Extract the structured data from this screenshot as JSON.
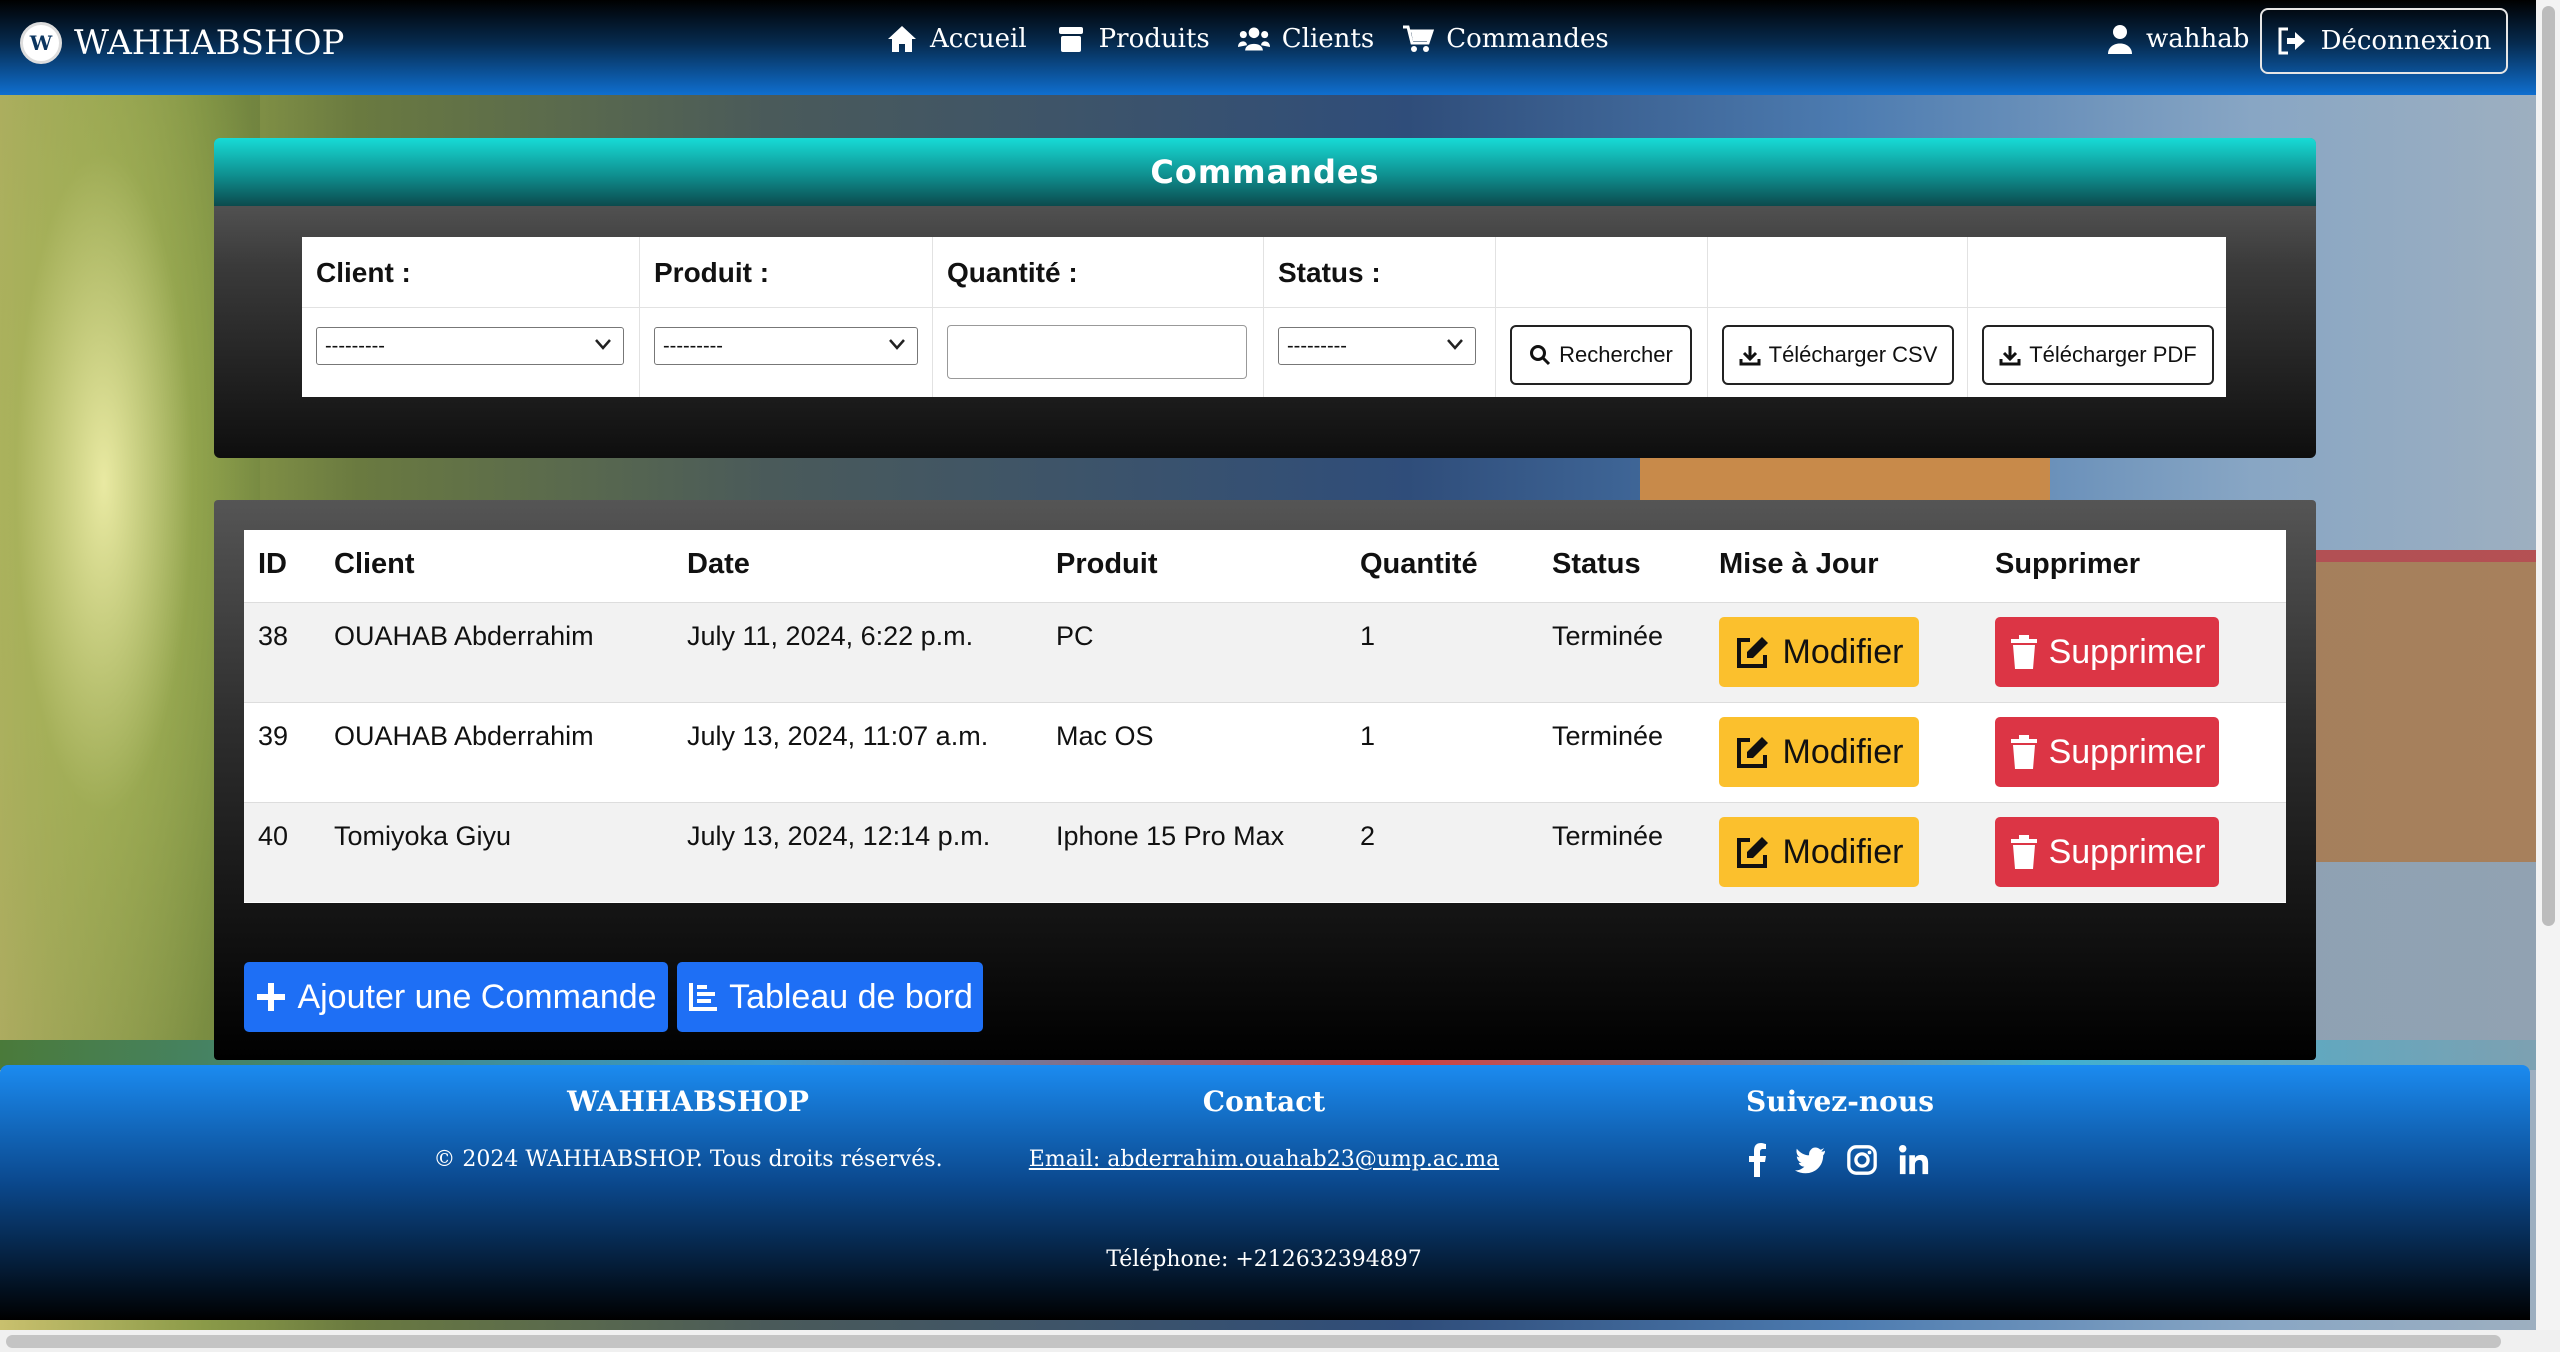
{
  "navbar": {
    "brand": "WAHHABSHOP",
    "links": [
      "Accueil",
      "Produits",
      "Clients",
      "Commandes"
    ],
    "user": "wahhab",
    "logout": "Déconnexion"
  },
  "filter": {
    "title": "Commandes",
    "labels": {
      "client": "Client :",
      "produit": "Produit :",
      "quantite": "Quantité :",
      "status": "Status :"
    },
    "client_selected": "---------",
    "produit_selected": "---------",
    "status_selected": "---------",
    "quantite_value": "",
    "search_btn": "Rechercher",
    "csv_btn": "Télécharger CSV",
    "pdf_btn": "Télécharger PDF"
  },
  "orders": {
    "columns": [
      "ID",
      "Client",
      "Date",
      "Produit",
      "Quantité",
      "Status",
      "Mise à Jour",
      "Supprimer"
    ],
    "rows": [
      {
        "id": "38",
        "client": "OUAHAB Abderrahim",
        "date": "July 11, 2024, 6:22 p.m.",
        "produit": "PC",
        "quantite": "1",
        "status": "Terminée"
      },
      {
        "id": "39",
        "client": "OUAHAB Abderrahim",
        "date": "July 13, 2024, 11:07 a.m.",
        "produit": "Mac OS",
        "quantite": "1",
        "status": "Terminée"
      },
      {
        "id": "40",
        "client": "Tomiyoka Giyu",
        "date": "July 13, 2024, 12:14 p.m.",
        "produit": "Iphone 15 Pro Max",
        "quantite": "2",
        "status": "Terminée"
      }
    ],
    "modify_label": "Modifier",
    "delete_label": "Supprimer",
    "add_btn": "Ajouter une Commande",
    "dashboard_btn": "Tableau de bord"
  },
  "footer": {
    "brand_title": "WAHHABSHOP",
    "copyright": "© 2024 WAHHABSHOP. Tous droits réservés.",
    "contact_title": "Contact",
    "email": "Email: abderrahim.ouahab23@ump.ac.ma",
    "phone": "Téléphone: +212632394897",
    "follow_title": "Suivez-nous",
    "socials": [
      "facebook-icon",
      "twitter-icon",
      "instagram-icon",
      "linkedin-icon"
    ]
  },
  "colors": {
    "modify": "#fbc02d",
    "delete": "#dc3545",
    "primary": "#1e6ff5",
    "header_teal": "#17dbd6"
  }
}
